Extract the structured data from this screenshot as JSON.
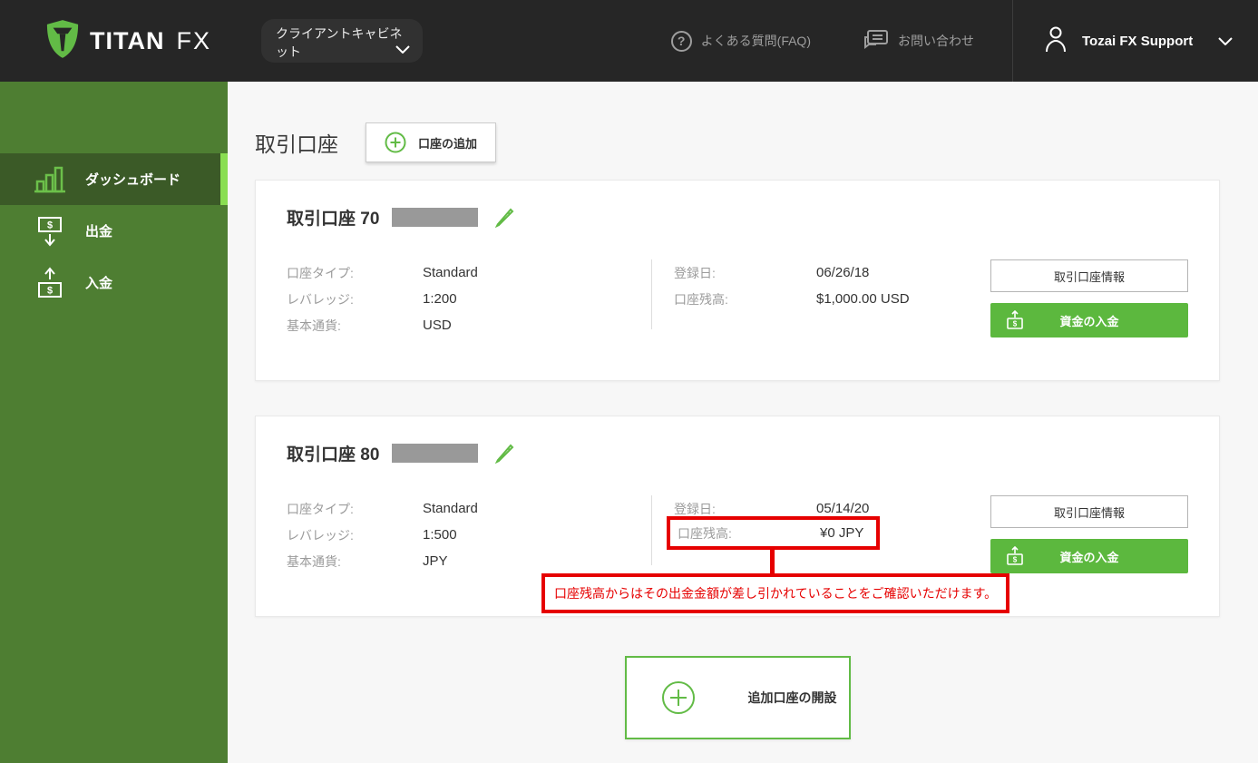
{
  "colors": {
    "header_bg": "#262626",
    "sidebar_green": "#4e7e32",
    "sidebar_active_green": "#3b5a27",
    "accent_green": "#8ade52",
    "brand_green": "#62bb46",
    "button_green": "#5cb83e",
    "alert_red": "#e60000"
  },
  "header": {
    "brand": {
      "name": "TITAN",
      "suffix": "FX",
      "logo_icon": "shield-icon"
    },
    "cabinet_dropdown": {
      "label": "クライアントキャビネット",
      "icon": "chevron-down-icon"
    },
    "faq": {
      "label": "よくある質問(FAQ)",
      "icon": "question-circle-icon"
    },
    "contact": {
      "label": "お問い合わせ",
      "icon": "chat-icon"
    },
    "user": {
      "name": "Tozai FX Support",
      "icon": "person-icon",
      "chevron": "chevron-down-icon"
    }
  },
  "sidebar": {
    "items": [
      {
        "label": "ダッシュボード",
        "icon": "bar-chart-icon",
        "active": true
      },
      {
        "label": "出金",
        "icon": "withdraw-icon",
        "active": false
      },
      {
        "label": "入金",
        "icon": "deposit-icon",
        "active": false
      }
    ]
  },
  "main": {
    "page_title": "取引口座",
    "add_account_button": "口座の追加",
    "accounts": [
      {
        "title": "取引口座 70",
        "number_masked": true,
        "details": [
          {
            "label": "口座タイプ:",
            "value": "Standard"
          },
          {
            "label": "レバレッジ:",
            "value": "1:200"
          },
          {
            "label": "基本通貨:",
            "value": "USD"
          }
        ],
        "summary": [
          {
            "label": "登録日:",
            "value": "06/26/18"
          },
          {
            "label": "口座残高:",
            "value": "$1,000.00 USD"
          }
        ],
        "info_button": "取引口座情報",
        "deposit_button": "資金の入金"
      },
      {
        "title": "取引口座 80",
        "number_masked": true,
        "details": [
          {
            "label": "口座タイプ:",
            "value": "Standard"
          },
          {
            "label": "レバレッジ:",
            "value": "1:500"
          },
          {
            "label": "基本通貨:",
            "value": "JPY"
          }
        ],
        "summary": [
          {
            "label": "登録日:",
            "value": "05/14/20"
          },
          {
            "label": "口座残高:",
            "value": "¥0 JPY"
          }
        ],
        "info_button": "取引口座情報",
        "deposit_button": "資金の入金"
      }
    ],
    "annotation": {
      "highlighted_field": "口座残高",
      "text": "口座残高からはその出金金額が差し引かれていることをご確認いただけます。"
    },
    "open_account_button": "追加口座の開設"
  }
}
